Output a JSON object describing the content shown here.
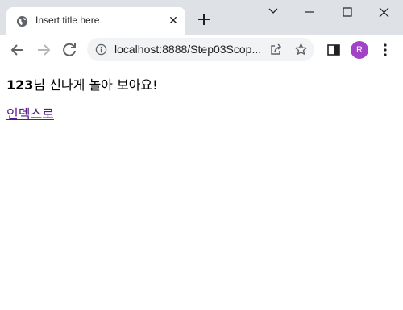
{
  "browser": {
    "tab": {
      "title": "Insert title here"
    },
    "address_bar": {
      "url": "localhost:8888/Step03Scop..."
    },
    "profile": {
      "initial": "R",
      "color": "#a142c7"
    }
  },
  "page": {
    "greeting": {
      "name": "123",
      "message": "님 신나게 놀아 보아요!"
    },
    "link": {
      "label": "인덱스로"
    }
  },
  "icons": [
    "globe-icon",
    "close-icon",
    "plus-icon",
    "chevron-down-icon",
    "minimize-icon",
    "maximize-icon",
    "close-window-icon",
    "back-arrow-icon",
    "forward-arrow-icon",
    "reload-icon",
    "info-icon",
    "share-icon",
    "star-icon",
    "side-panel-icon",
    "more-vert-icon"
  ]
}
